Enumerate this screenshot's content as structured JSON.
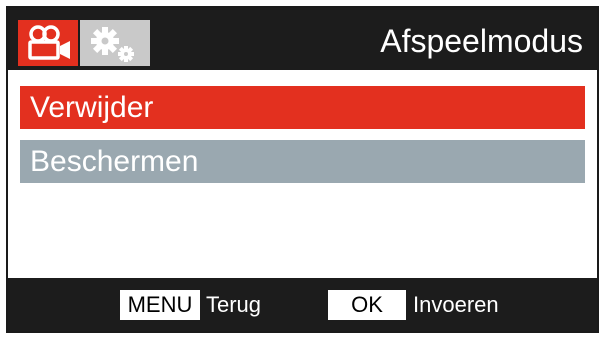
{
  "header": {
    "title": "Afspeelmodus",
    "tabs": [
      {
        "name": "video-camera-icon",
        "active": true
      },
      {
        "name": "settings-gears-icon",
        "active": false
      }
    ]
  },
  "menu": {
    "items": [
      {
        "label": "Verwijder",
        "selected": true
      },
      {
        "label": "Beschermen",
        "selected": false
      }
    ]
  },
  "footer": {
    "menu_key": "MENU",
    "menu_action": "Terug",
    "ok_key": "OK",
    "ok_action": "Invoeren"
  },
  "colors": {
    "accent": "#e3301f",
    "header_bg": "#1c1c1c",
    "inactive_item": "#9aa8b0",
    "inactive_tab": "#c9c9c9"
  }
}
